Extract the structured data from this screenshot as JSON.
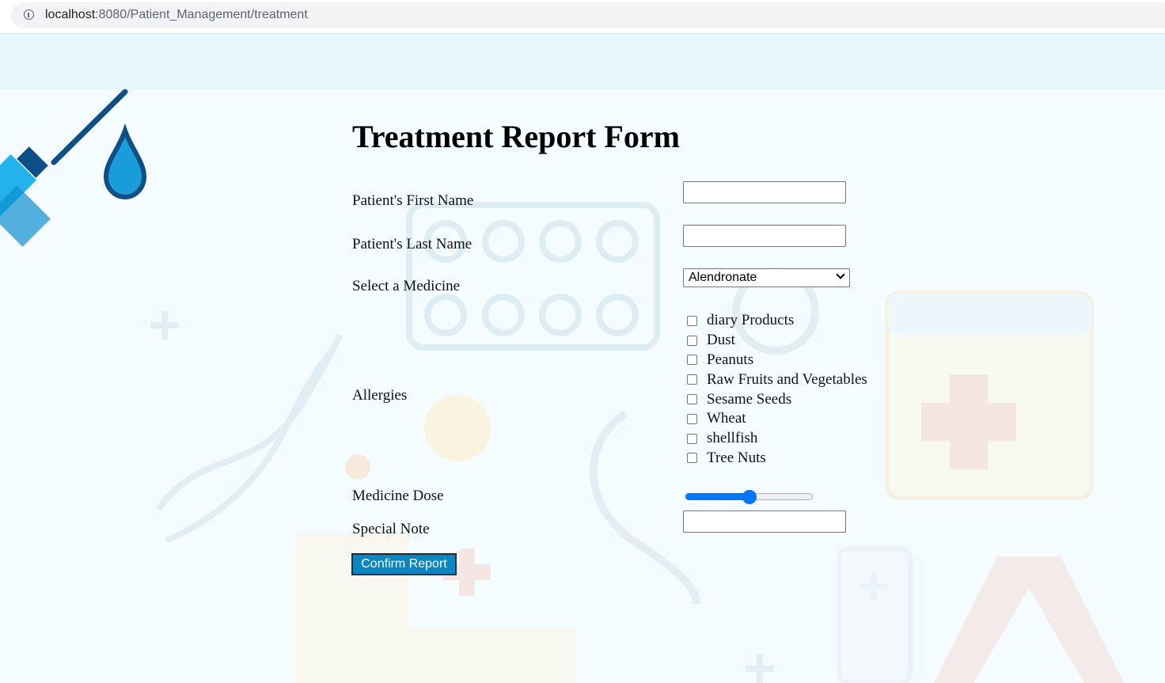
{
  "browser": {
    "url_host": "localhost",
    "url_rest": ":8080/Patient_Management/treatment"
  },
  "form": {
    "title": "Treatment Report Form",
    "first_name": {
      "label": "Patient's First Name",
      "value": ""
    },
    "last_name": {
      "label": "Patient's Last Name",
      "value": ""
    },
    "medicine": {
      "label": "Select a Medicine",
      "selected": "Alendronate"
    },
    "allergies": {
      "label": "Allergies",
      "options": [
        {
          "label": "diary Products",
          "checked": false
        },
        {
          "label": "Dust",
          "checked": false
        },
        {
          "label": "Peanuts",
          "checked": false
        },
        {
          "label": "Raw Fruits and Vegetables",
          "checked": false
        },
        {
          "label": "Sesame Seeds",
          "checked": false
        },
        {
          "label": "Wheat",
          "checked": false
        },
        {
          "label": "shellfish",
          "checked": false
        },
        {
          "label": "Tree Nuts",
          "checked": false
        }
      ]
    },
    "dose": {
      "label": "Medicine Dose",
      "fraction": 0.5
    },
    "special_note": {
      "label": "Special Note",
      "value": ""
    },
    "submit_label": "Confirm Report"
  },
  "colors": {
    "page_background": "#f5fcff",
    "accent": "#0075ff",
    "button": "#0a87c3"
  },
  "icons": {
    "background": [
      "syringe-icon",
      "drop-icon",
      "pill-pack-icon",
      "dna-icon",
      "stethoscope-icon",
      "hospital-building-icon",
      "calendar-icon",
      "medicine-bottle-icon",
      "ribbon-icon",
      "plus-icon"
    ]
  }
}
